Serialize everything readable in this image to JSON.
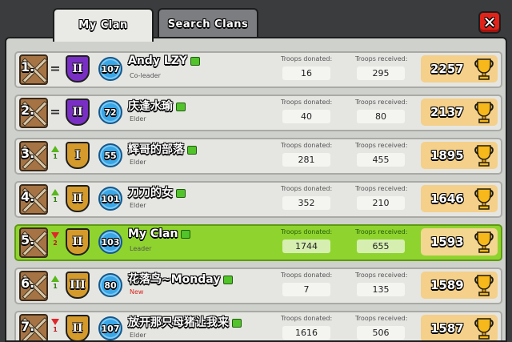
{
  "tabs": {
    "my_clan": "My Clan",
    "search_clans": "Search Clans"
  },
  "close_label": "✕",
  "labels": {
    "donated": "Troops donated:",
    "received": "Troops received:"
  },
  "members": [
    {
      "rank": "1.",
      "change": "=",
      "change_count": "",
      "badge": "II",
      "badge_color": "#7a2fc4",
      "level": "107",
      "name": "Andy LZY",
      "role": "Co-leader",
      "donated": "16",
      "received": "295",
      "trophies": "2257",
      "highlight": false
    },
    {
      "rank": "2.",
      "change": "=",
      "change_count": "",
      "badge": "II",
      "badge_color": "#7a2fc4",
      "level": "72",
      "name": "庆逢水瑜",
      "role": "Elder",
      "donated": "40",
      "received": "80",
      "trophies": "2137",
      "highlight": false
    },
    {
      "rank": "3.",
      "change": "up",
      "change_count": "1",
      "badge": "I",
      "badge_color": "#d49a2b",
      "level": "55",
      "name": "辉哥的部落",
      "role": "Elder",
      "donated": "281",
      "received": "455",
      "trophies": "1895",
      "highlight": false
    },
    {
      "rank": "4.",
      "change": "up",
      "change_count": "1",
      "badge": "II",
      "badge_color": "#d49a2b",
      "level": "101",
      "name": "刀刀的女",
      "role": "Elder",
      "donated": "352",
      "received": "210",
      "trophies": "1646",
      "highlight": false
    },
    {
      "rank": "5.",
      "change": "down",
      "change_count": "2",
      "badge": "II",
      "badge_color": "#d49a2b",
      "level": "103",
      "name": "My Clan",
      "role": "Leader",
      "donated": "1744",
      "received": "655",
      "trophies": "1593",
      "highlight": true
    },
    {
      "rank": "6.",
      "change": "up",
      "change_count": "1",
      "badge": "III",
      "badge_color": "#d49a2b",
      "level": "80",
      "name": "花落鸟~Monday",
      "role": "New",
      "donated": "7",
      "received": "135",
      "trophies": "1589",
      "highlight": false
    },
    {
      "rank": "7.",
      "change": "down",
      "change_count": "1",
      "badge": "II",
      "badge_color": "#d49a2b",
      "level": "107",
      "name": "放开那只母猪让我来",
      "role": "Elder",
      "donated": "1616",
      "received": "506",
      "trophies": "1587",
      "highlight": false
    }
  ]
}
